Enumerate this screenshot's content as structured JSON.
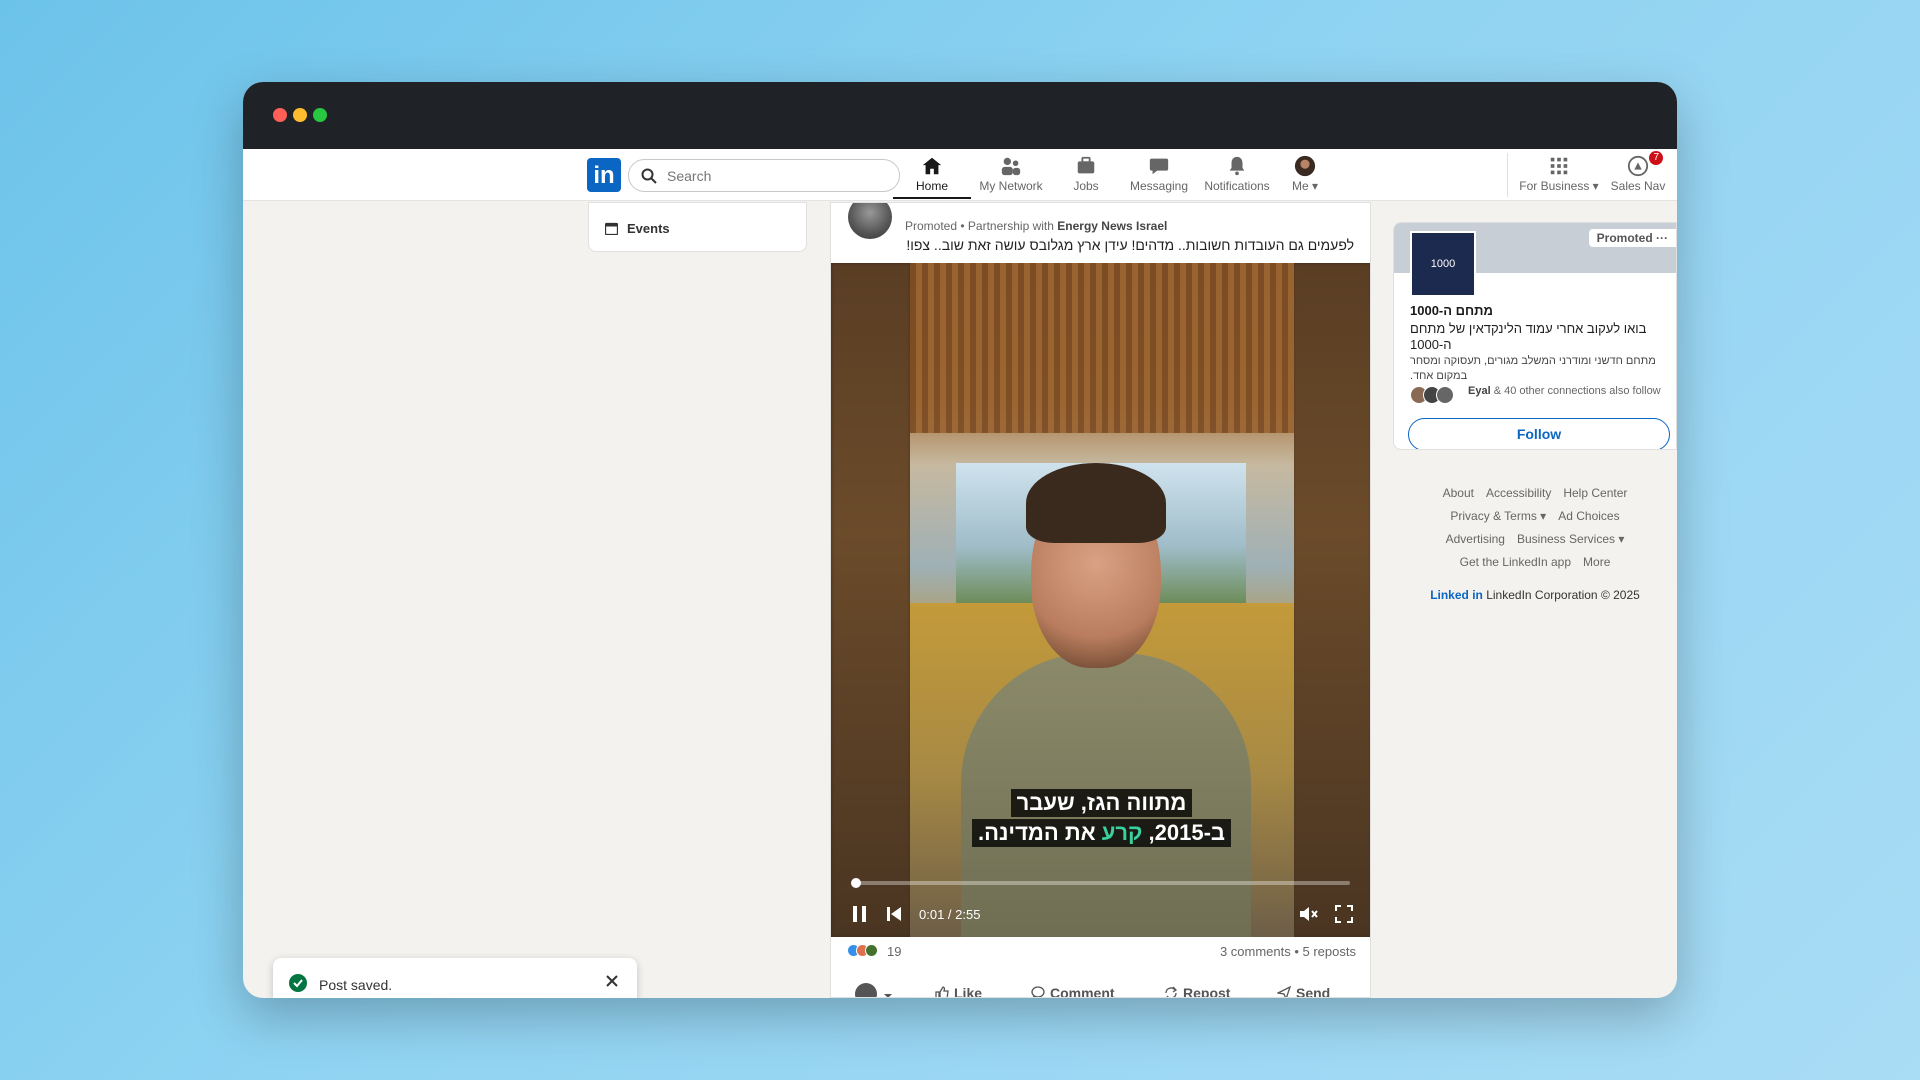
{
  "nav": {
    "logo": "in",
    "search_placeholder": "Search",
    "items": [
      {
        "label": "Home",
        "icon": "home-icon"
      },
      {
        "label": "My Network",
        "icon": "network-icon"
      },
      {
        "label": "Jobs",
        "icon": "jobs-icon"
      },
      {
        "label": "Messaging",
        "icon": "messaging-icon"
      },
      {
        "label": "Notifications",
        "icon": "bell-icon"
      },
      {
        "label": "Me ▾",
        "icon": "avatar"
      },
      {
        "label": "For Business ▾",
        "icon": "grid-icon"
      },
      {
        "label": "Sales Nav",
        "icon": "sales-nav-icon"
      }
    ],
    "sales_badge": "7"
  },
  "sidebar": {
    "events_label": "Events"
  },
  "post": {
    "promoted_prefix": "Promoted • Partnership with ",
    "partner": "Energy News Israel",
    "text": "לפעמים גם העובדות חשובות.. מדהים! עידן ארץ מגלובס עושה זאת שוב.. צפו!",
    "caption_line1": "מתווה הגז, שעבר",
    "caption_line2_a": "ב-2015, ",
    "caption_line2_hl": "קרע",
    "caption_line2_b": " את המדינה.",
    "time": "0:01 / 2:55",
    "progress": 0.006,
    "reaction_count": "19",
    "comments_reposts": "3 comments • 5 reposts",
    "actions": {
      "like": "Like",
      "comment": "Comment",
      "repost": "Repost",
      "send": "Send"
    }
  },
  "ad": {
    "promoted": "Promoted ···",
    "logo_text": "1000",
    "title": "מתחם ה-1000",
    "text": "בואו לעקוב אחרי עמוד הלינקדאין של מתחם ה-1000",
    "sub": "מתחם חדשני ומודרני המשלב מגורים, תעסוקה ומסחר במקום אחד.",
    "connections_name": "Eyal",
    "connections_rest": " & 40 other connections also follow",
    "follow": "Follow"
  },
  "footer": {
    "row1": [
      "About",
      "Accessibility",
      "Help Center"
    ],
    "row2": [
      "Privacy & Terms ▾",
      "Ad Choices"
    ],
    "row3": [
      "Advertising",
      "Business Services ▾"
    ],
    "row4": [
      "Get the LinkedIn app",
      "More"
    ],
    "brand_logo": "Linked in",
    "brand_text": "LinkedIn Corporation © 2025"
  },
  "toast": {
    "message": "Post saved."
  },
  "colors": {
    "brand": "#0a66c2",
    "background": "#f4f2ee",
    "titlebar": "#1f2327"
  }
}
